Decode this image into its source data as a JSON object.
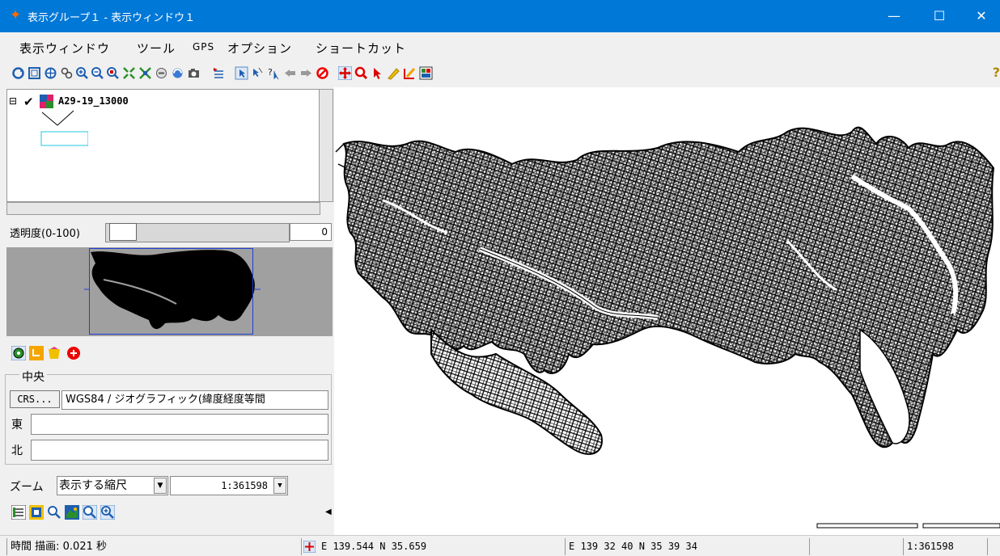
{
  "window": {
    "title": "表示グループ１ - 表示ウィンドウ１",
    "minimize_glyph": "—",
    "maximize_glyph": "☐",
    "close_glyph": "✕"
  },
  "menu": [
    "表示ウィンドウ",
    "ツール",
    "GPS",
    "オプション",
    "ショートカット"
  ],
  "toolbar": {
    "icons": [
      "refresh-icon",
      "extent-icon",
      "pan-center-icon",
      "layers-icon",
      "zoom-in-icon",
      "zoom-out-icon",
      "zoom-box-icon",
      "zoom-full-icon",
      "zoom-layer-icon",
      "zoom-group-icon",
      "refresh-view-icon",
      "snapshot-icon",
      "add-layer-icon",
      "select-single-icon",
      "select-multi-icon",
      "query-icon",
      "back-icon",
      "forward-icon",
      "stop-icon",
      "pan-icon",
      "zoom-icon",
      "pointer-icon",
      "sketch-icon",
      "edit-icon",
      "legend-icon"
    ],
    "help_glyph": "?"
  },
  "layer": {
    "name": "A29-19_13000",
    "expand_glyph": "⊟",
    "check_glyph": "✔"
  },
  "transparency": {
    "label": "透明度(0-100)",
    "value": "0",
    "level": 0
  },
  "center": {
    "group_label": "中央",
    "crs_button": "CRS...",
    "crs_value": "WGS84 / ジオグラフィック(緯度経度等間",
    "east_label": "東",
    "north_label": "北",
    "east_value": "",
    "north_value": ""
  },
  "zoom": {
    "label": "ズーム",
    "mode": "表示する縮尺",
    "scale": "1:361598",
    "arrow_glyph": "▼"
  },
  "panel_buttons_top": [
    "locate-icon",
    "undo-icon",
    "bookmark-icon",
    "close-circle-icon"
  ],
  "panel_buttons_bottom": [
    "legend-list-icon",
    "extent-square-icon",
    "magnifier-icon",
    "map-layer-icon",
    "zoom-box-icon",
    "zoom-in-icon"
  ],
  "collapse_glyph": "◀",
  "status": {
    "time": "時間 描画: 0.021 秒",
    "decimal_coord": "E 139.544  N 35.659",
    "dms_coord": "E 139 32 40  N 35 39 34",
    "empty": "",
    "scale": "1:361598"
  },
  "colors": {
    "titlebar": "#0078d7",
    "map_lines": "#000000",
    "river": "#ffffff",
    "overview_bg": "#a0a0a0",
    "overview_frame": "#1f3fd6"
  }
}
